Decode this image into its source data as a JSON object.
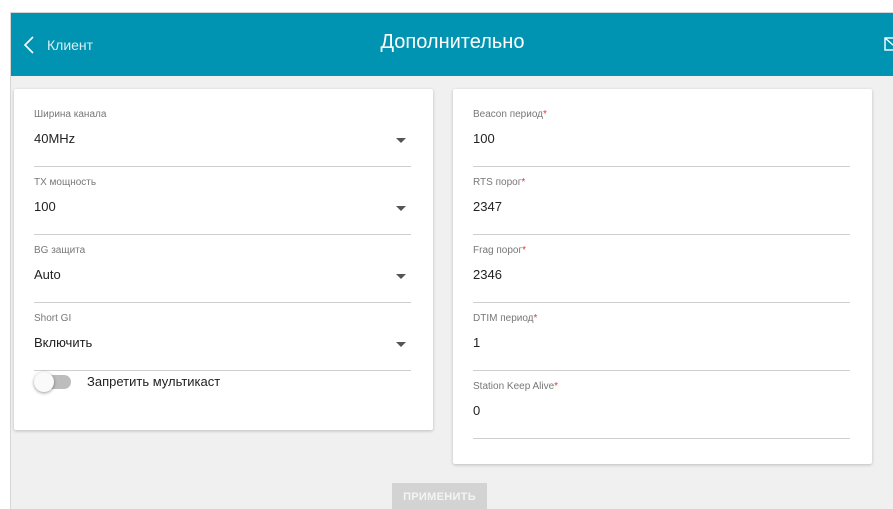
{
  "header": {
    "back_label": "Клиент",
    "title": "Дополнительно",
    "accent": "#0094b2"
  },
  "left": {
    "fields": [
      {
        "label": "Ширина канала",
        "value": "40MHz"
      },
      {
        "label": "TX мощность",
        "value": "100"
      },
      {
        "label": "BG защита",
        "value": "Auto"
      },
      {
        "label": "Short GI",
        "value": "Включить"
      }
    ],
    "toggle": {
      "label": "Запретить мультикаст",
      "on": false
    }
  },
  "right": {
    "fields": [
      {
        "label": "Beacon период",
        "required": "*",
        "value": "100"
      },
      {
        "label": "RTS порог",
        "required": "*",
        "value": "2347"
      },
      {
        "label": "Frag порог",
        "required": "*",
        "value": "2346"
      },
      {
        "label": "DTIM период",
        "required": "*",
        "value": "1"
      },
      {
        "label": "Station Keep Alive",
        "required": "*",
        "value": "0"
      }
    ]
  },
  "actions": {
    "apply_label": "ПРИМЕНИТЬ"
  }
}
